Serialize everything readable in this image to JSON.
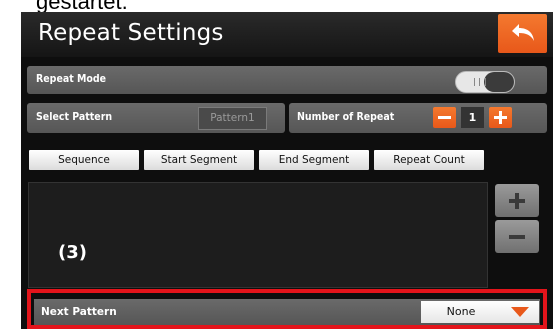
{
  "caption": "gestartet.",
  "header": {
    "title": "Repeat Settings",
    "back_icon": "back-arrow-icon"
  },
  "repeat_mode": {
    "label": "Repeat Mode",
    "toggle_on": false
  },
  "select_pattern": {
    "label": "Select Pattern",
    "value": "Pattern1"
  },
  "number_of_repeat": {
    "label": "Number of Repeat",
    "value": "1"
  },
  "columns": [
    "Sequence",
    "Start Segment",
    "End Segment",
    "Repeat Count"
  ],
  "annotation": "(3)",
  "next_pattern": {
    "label": "Next Pattern",
    "value": "None"
  },
  "colors": {
    "accent": "#e8581a",
    "highlight_frame": "#e3141b"
  }
}
